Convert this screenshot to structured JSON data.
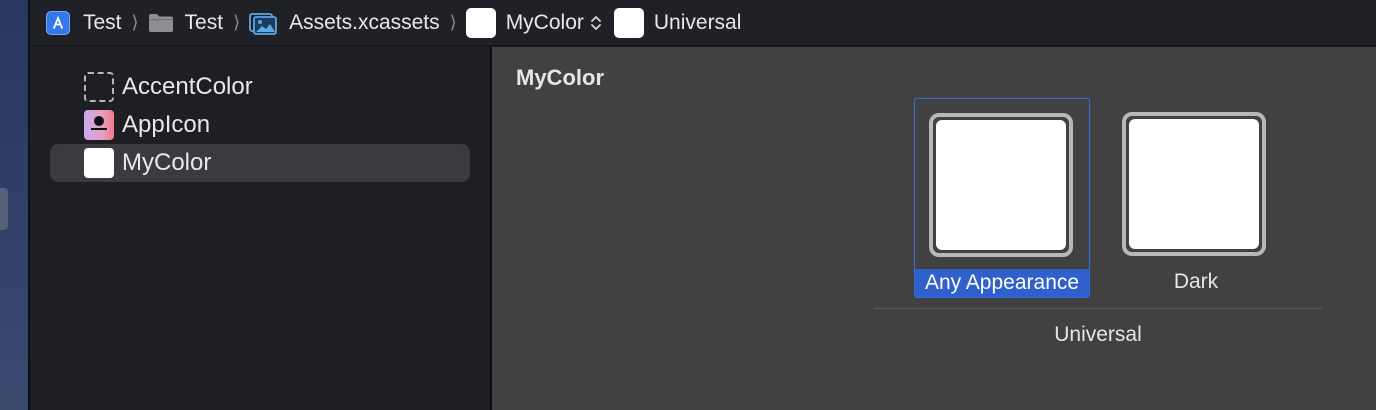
{
  "jumpbar": {
    "project": "Test",
    "folder": "Test",
    "catalog": "Assets.xcassets",
    "asset": "MyColor",
    "appearance": "Universal"
  },
  "sidebar": {
    "items": [
      {
        "label": "AccentColor",
        "thumb": "dashed-empty"
      },
      {
        "label": "AppIcon",
        "thumb": "app-icon"
      },
      {
        "label": "MyColor",
        "thumb": "white-swatch",
        "selected": true
      }
    ]
  },
  "editor": {
    "title": "MyColor",
    "slots": [
      {
        "label": "Any Appearance",
        "color": "#ffffff",
        "selected": true
      },
      {
        "label": "Dark",
        "color": "#ffffff",
        "selected": false
      }
    ],
    "group_label": "Universal"
  },
  "colors": {
    "selection_blue": "#2f60cc",
    "editor_bg": "#414141",
    "sidebar_bg": "#1e1f24"
  },
  "icons": [
    "app-icon",
    "folder-icon",
    "asset-catalog-icon",
    "chevron-right-icon",
    "chevron-up-down-icon",
    "color-swatch-icon"
  ]
}
